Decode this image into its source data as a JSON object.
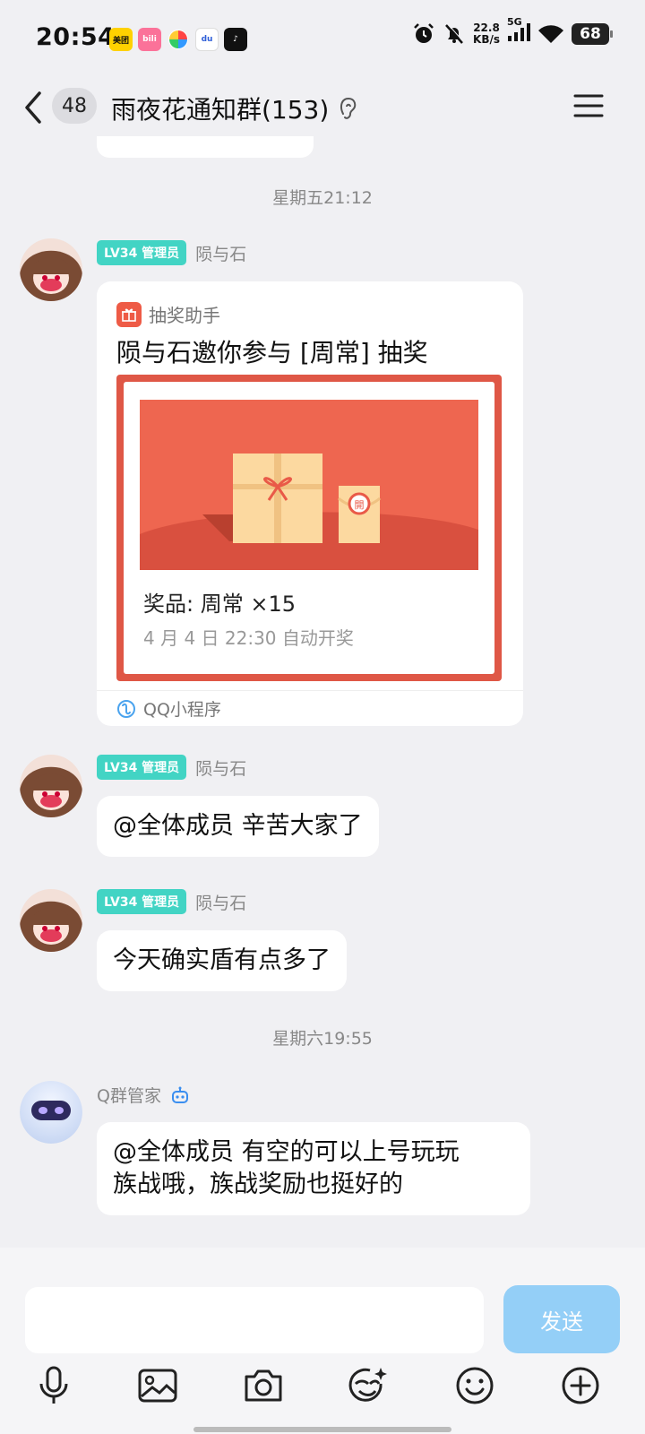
{
  "status_bar": {
    "time": "20:54",
    "apps": [
      {
        "name": "meituan-icon",
        "label": "美团",
        "color": "#ffd100",
        "text": "#111"
      },
      {
        "name": "bilibili-icon",
        "label": "bili",
        "color": "#fb7299",
        "text": "#fff"
      },
      {
        "name": "pinwheel-icon",
        "label": "",
        "color": "#ffffff",
        "text": "#fff"
      },
      {
        "name": "baidu-icon",
        "label": "du",
        "color": "#ffffff",
        "text": "#2f5fd8"
      },
      {
        "name": "tiktok-icon",
        "label": "♪",
        "color": "#111111",
        "text": "#fff"
      }
    ],
    "net_speed": "22.8",
    "net_unit": "KB/s",
    "network": "5G",
    "battery": "68"
  },
  "header": {
    "unread_count": "48",
    "title": "雨夜花通知群(153)"
  },
  "messages": {
    "ts1": "星期五21:12",
    "m1": {
      "badge": "LV34 管理员",
      "sender": "陨与石",
      "card": {
        "app_name": "抽奖助手",
        "title": "陨与石邀你参与 [周常] 抽奖",
        "prize": "奖品: 周常  ×15",
        "draw_time": "4 月 4 日 22:30 自动开奖",
        "footer": "QQ小程序"
      }
    },
    "m2": {
      "badge": "LV34 管理员",
      "sender": "陨与石",
      "text": "@全体成员 辛苦大家了"
    },
    "m3": {
      "badge": "LV34 管理员",
      "sender": "陨与石",
      "text": "今天确实盾有点多了"
    },
    "ts2": "星期六19:55",
    "m4": {
      "sender": "Q群管家",
      "line1": "@全体成员 有空的可以上号玩玩",
      "line2": "族战哦，族战奖励也挺好的"
    }
  },
  "input_bar": {
    "placeholder": "",
    "send_label": "发送"
  },
  "colors": {
    "accent_blue": "#8acbf8",
    "badge_teal": "#42d4c4",
    "lottery_red": "#df5746"
  }
}
